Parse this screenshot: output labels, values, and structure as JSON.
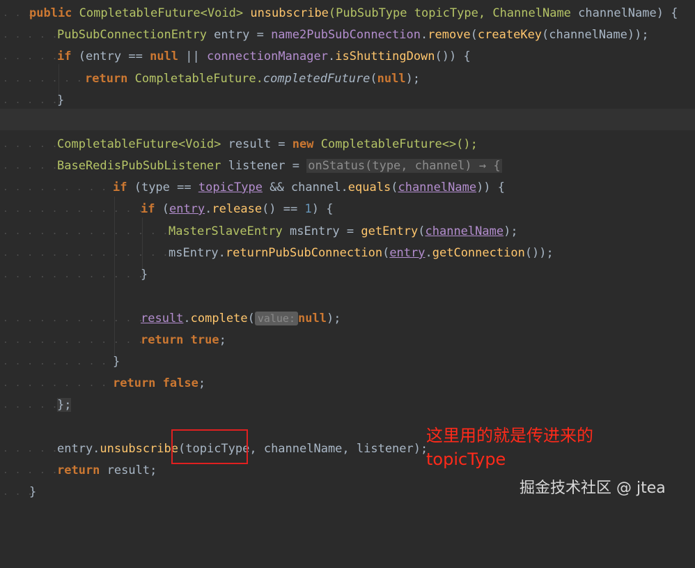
{
  "code_lines": {
    "l1": {
      "kw_public": "public",
      "type": "CompletableFuture<Void>",
      "method": "unsubscribe",
      "params_a": "(PubSubType topicType, ",
      "param_type": "ChannelName",
      "params_b": " channelName) {"
    },
    "l2": {
      "type": "PubSubConnectionEntry",
      "rest_a": " entry = ",
      "field": "name2PubSubConnection",
      "dot": ".",
      "call": "remove",
      "rest_b": "(",
      "call2": "createKey",
      "rest_c": "(channelName));"
    },
    "l3": {
      "kw": "if",
      "rest_a": " (entry == ",
      "null": "null",
      "rest_b": " || ",
      "field": "connectionManager",
      "dot": ".",
      "call": "isShuttingDown",
      "rest_c": "()) {"
    },
    "l4": {
      "kw": "return",
      "rest_a": " CompletableFuture.",
      "call": "completedFuture",
      "rest_b": "(",
      "null": "null",
      "rest_c": ");"
    },
    "l5": {
      "text": "}"
    },
    "l7": {
      "type": "CompletableFuture<Void>",
      "rest_a": " result = ",
      "kw": "new",
      "rest_b": " CompletableFuture<>();"
    },
    "l8": {
      "type": "BaseRedisPubSubListener",
      "rest_a": " listener = ",
      "lambda": "onStatus(type, channel) → {"
    },
    "l9": {
      "kw": "if",
      "rest_a": " (type == ",
      "u1": "topicType",
      "rest_b": " && channel.",
      "call": "equals",
      "rest_c": "(",
      "u2": "channelName",
      "rest_d": ")) {"
    },
    "l10": {
      "kw": "if",
      "rest_a": " (",
      "u1": "entry",
      "rest_b": ".",
      "call": "release",
      "rest_c": "() == ",
      "num": "1",
      "rest_d": ") {"
    },
    "l11": {
      "type": "MasterSlaveEntry",
      "rest_a": " msEntry = ",
      "call": "getEntry",
      "rest_b": "(",
      "u1": "channelName",
      "rest_c": ");"
    },
    "l12": {
      "rest_a": "msEntry.",
      "call": "returnPubSubConnection",
      "rest_b": "(",
      "u1": "entry",
      "rest_c": ".",
      "call2": "getConnection",
      "rest_d": "());"
    },
    "l13": {
      "text": "}"
    },
    "l15": {
      "u1": "result",
      "rest_a": ".",
      "call": "complete",
      "rest_b": "(",
      "hint": "value:",
      "kw": "null",
      "rest_c": ");"
    },
    "l16": {
      "kw": "return",
      "kw2": "true",
      "rest_a": ";"
    },
    "l17": {
      "text": "}"
    },
    "l18": {
      "kw": "return",
      "kw2": "false",
      "rest_a": ";"
    },
    "l19": {
      "text": "};"
    },
    "l21": {
      "rest_a": "entry.",
      "call": "unsubscribe",
      "rest_b": "(topicType, channelName, listener);"
    },
    "l22": {
      "kw": "return",
      "rest_a": " result;"
    },
    "l23": {
      "text": "}"
    }
  },
  "annotation": {
    "line1": "这里用的就是传进来的",
    "line2": "topicType"
  },
  "watermark": "掘金技术社区 @ jtea",
  "colors": {
    "background": "#2b2b2b",
    "keyword": "#cc7832",
    "type": "#b5c466",
    "method": "#ffc66d",
    "field": "#b48ecf",
    "annotation": "#ff2a1a"
  }
}
